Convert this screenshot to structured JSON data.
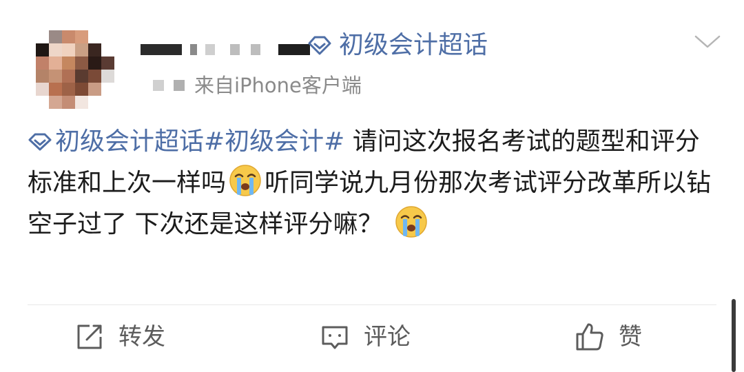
{
  "post": {
    "supertopic_label": "初级会计超话",
    "source": "来自iPhone客户端",
    "body": {
      "topic_tag_prefix": "初级会计超话",
      "hashtag": "#初级会计#",
      "line_a": " 请问这次报名考试的题型和评分标准和上次一样吗",
      "line_b": "听同学说九月份那次考试评分改革所以钻空子过了 下次还是这样评分嘛？",
      "emoji": "crying-face-icon"
    },
    "actions": {
      "repost_label": "转发",
      "comment_label": "评论",
      "like_label": "赞"
    }
  },
  "colors": {
    "link_blue": "#4e6ea6",
    "meta_gray": "#8a8a8a",
    "text": "#1c1c1c",
    "action_gray": "#5c5c5c"
  }
}
